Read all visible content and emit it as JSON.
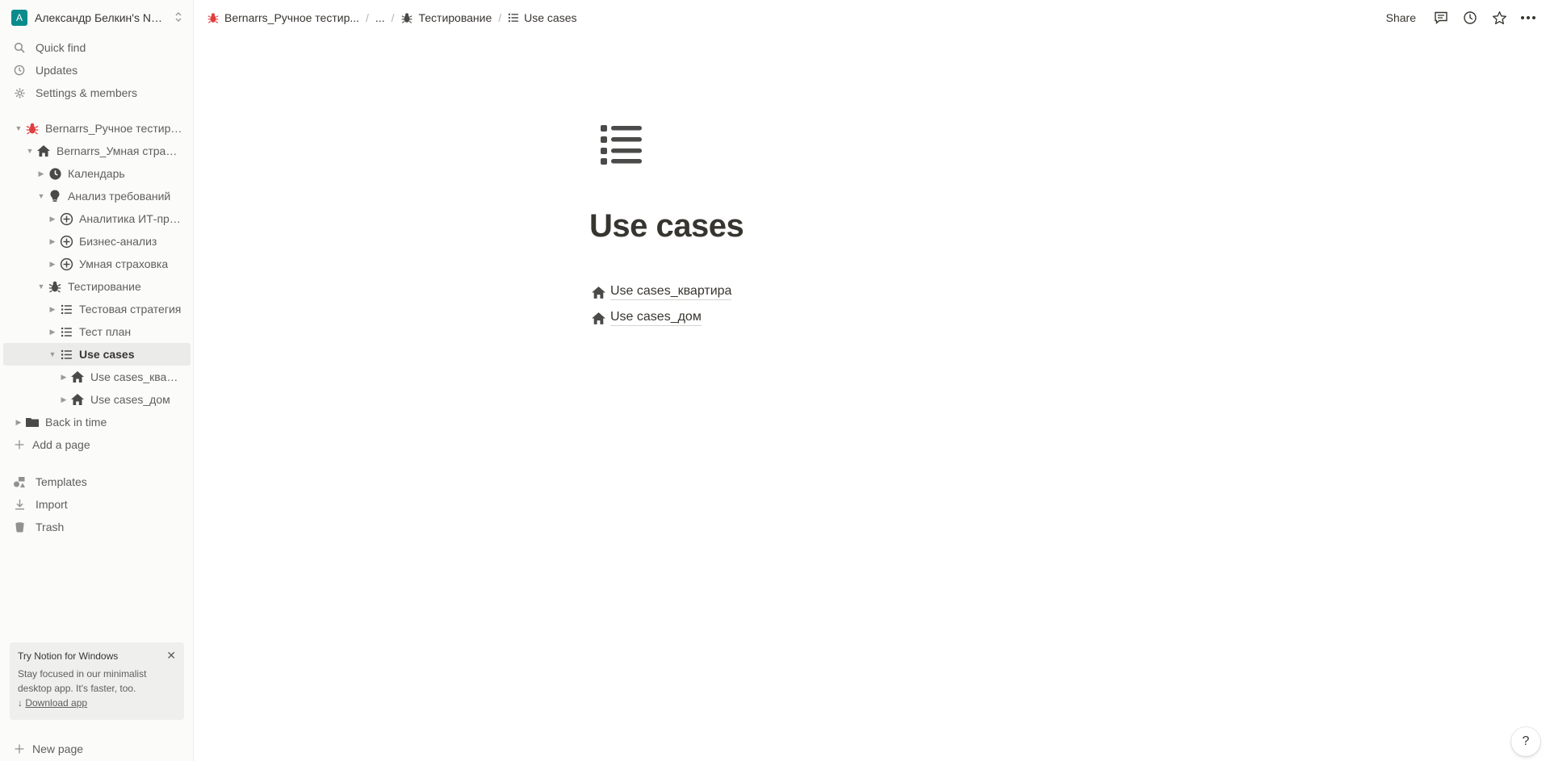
{
  "workspace": {
    "avatar_letter": "A",
    "name": "Александр Белкин's Not..."
  },
  "sidebar": {
    "quick_find": "Quick find",
    "updates": "Updates",
    "settings": "Settings & members",
    "tree": [
      {
        "label": "Bernarrs_Ручное тестиро...",
        "icon": "bug-icon-red"
      },
      {
        "label": "Bernarrs_Умная страхо...",
        "icon": "house-icon"
      },
      {
        "label": "Календарь",
        "icon": "clock-icon"
      },
      {
        "label": "Анализ требований",
        "icon": "lightbulb-icon"
      },
      {
        "label": "Аналитика ИТ-про...",
        "icon": "circle-plus-icon"
      },
      {
        "label": "Бизнес-анализ",
        "icon": "circle-plus-icon"
      },
      {
        "label": "Умная страховка",
        "icon": "circle-plus-icon"
      },
      {
        "label": "Тестирование",
        "icon": "bug-icon"
      },
      {
        "label": "Тестовая стратегия",
        "icon": "list-icon"
      },
      {
        "label": "Тест план",
        "icon": "list-icon"
      },
      {
        "label": "Use cases",
        "icon": "list-icon"
      },
      {
        "label": "Use cases_кварт...",
        "icon": "house-icon"
      },
      {
        "label": "Use cases_дом",
        "icon": "house-icon"
      },
      {
        "label": "Back in time",
        "icon": "folder-icon"
      }
    ],
    "add_page": "Add a page",
    "templates": "Templates",
    "import": "Import",
    "trash": "Trash",
    "promo": {
      "title": "Try Notion for Windows",
      "text": "Stay focused in our minimalist desktop app. It's faster, too.",
      "link": "Download app"
    },
    "new_page": "New page"
  },
  "breadcrumb": {
    "root": "Bernarrs_Ручное тестир...",
    "ellipsis": "...",
    "parent": "Тестирование",
    "current": "Use cases"
  },
  "topbar": {
    "share": "Share"
  },
  "page": {
    "title": "Use cases",
    "children": [
      "Use cases_квартира",
      "Use cases_дом"
    ]
  },
  "help": "?",
  "colors": {
    "accent_teal": "#0b8b8b",
    "bug_red": "#e03e3e",
    "text": "#37352f",
    "sidebar_bg": "#fbfbfa"
  }
}
